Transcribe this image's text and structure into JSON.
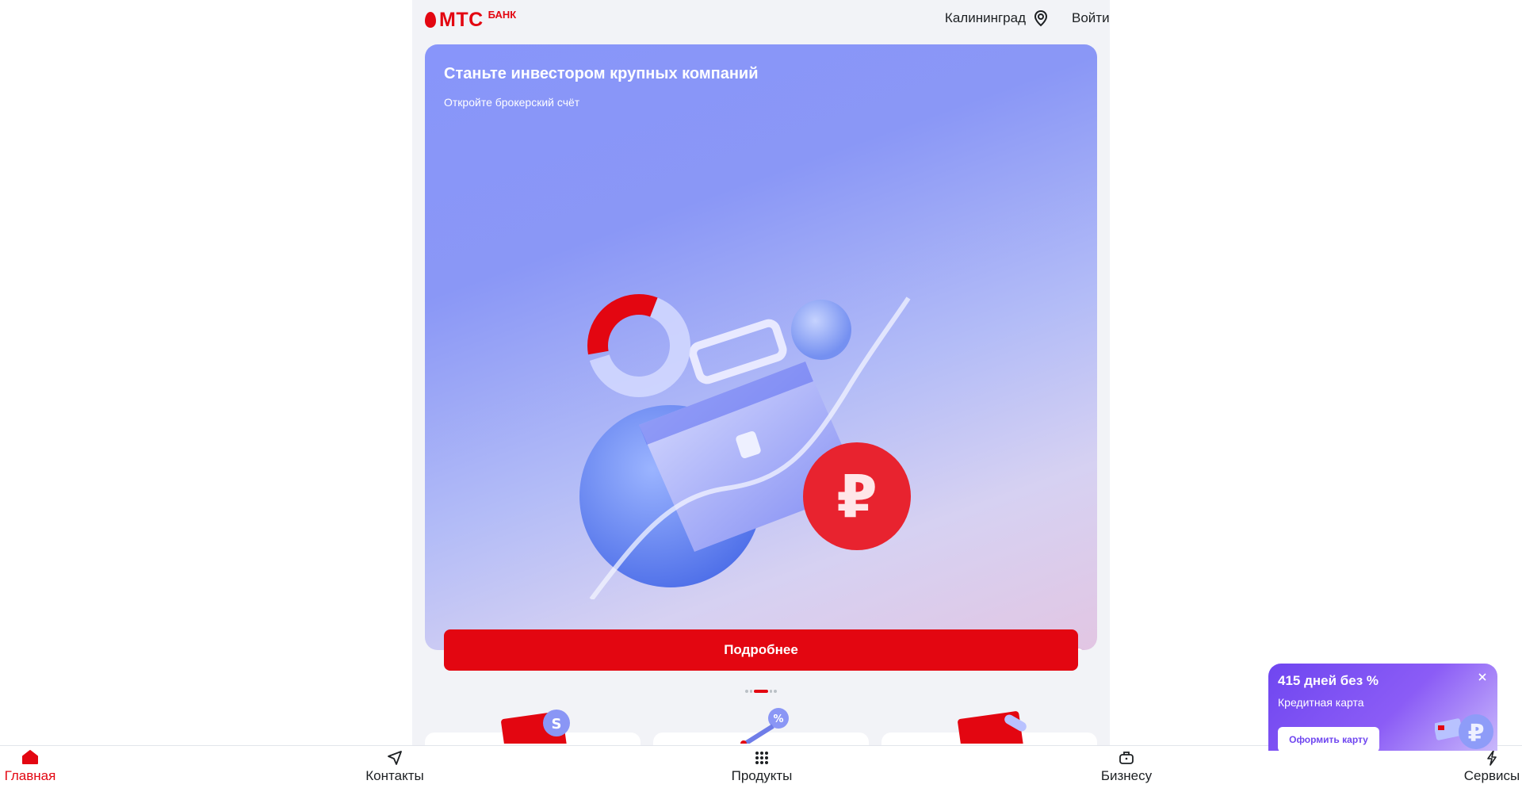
{
  "header": {
    "logo_text": "МТС",
    "logo_sub": "БАНК",
    "city": "Калининград",
    "login": "Войти"
  },
  "banner": {
    "title": "Станьте инвестором крупных компаний",
    "subtitle": "Откройте брокерский счёт",
    "button": "Подробнее",
    "slide_indicator": {
      "total": 5,
      "active": 2
    }
  },
  "tabbar": {
    "items": [
      {
        "label": "Главная",
        "icon": "home-icon",
        "active": true
      },
      {
        "label": "Контакты",
        "icon": "send-icon",
        "active": false
      },
      {
        "label": "Продукты",
        "icon": "grid-icon",
        "active": false
      },
      {
        "label": "Бизнесу",
        "icon": "briefcase-icon",
        "active": false
      },
      {
        "label": "Сервисы",
        "icon": "lightning-icon",
        "active": false
      }
    ]
  },
  "promo": {
    "title": "415 дней без %",
    "subtitle": "Кредитная карта",
    "button": "Оформить карту"
  },
  "colors": {
    "brand": "#e30611",
    "accent_violet": "#6f46f0",
    "page_bg": "#f2f3f7"
  }
}
